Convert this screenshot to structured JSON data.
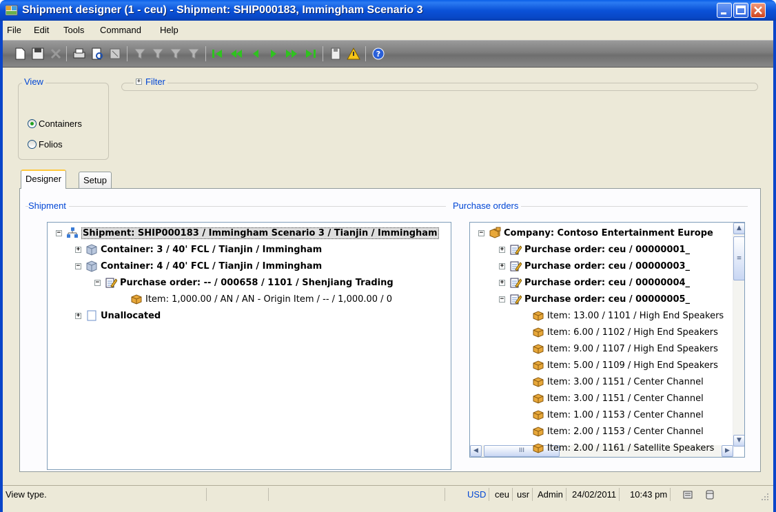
{
  "window": {
    "title": "Shipment designer (1 - ceu) - Shipment: SHIP000183, Immingham Scenario 3"
  },
  "menu": [
    "File",
    "Edit",
    "Tools",
    "Command",
    "Help"
  ],
  "view_group": {
    "legend": "View",
    "options": [
      {
        "label": "Containers",
        "selected": true
      },
      {
        "label": "Folios",
        "selected": false
      }
    ]
  },
  "filter_group": {
    "legend": "Filter",
    "expander": "+"
  },
  "tabs": [
    {
      "label": "Designer",
      "active": true
    },
    {
      "label": "Setup",
      "active": false
    }
  ],
  "shipment_panel": {
    "label": "Shipment",
    "nodes": [
      {
        "text": "Shipment: SHIP000183 / Immingham Scenario 3 / Tianjin / Immingham",
        "icon": "shipment-hierarchy-icon",
        "expander": "−",
        "bold": true,
        "selected": true
      },
      {
        "text": "Container: 3 / 40' FCL / Tianjin / Immingham",
        "icon": "container-icon",
        "expander": "+",
        "bold": true
      },
      {
        "text": "Container: 4 / 40' FCL / Tianjin / Immingham",
        "icon": "container-icon",
        "expander": "−",
        "bold": true
      },
      {
        "text": "Purchase order: -- / 000658 / 1101 / Shenjiang Trading",
        "icon": "purchase-order-icon",
        "expander": "−",
        "bold": true
      },
      {
        "text": "Item: 1,000.00 / AN / AN - Origin Item / -- / 1,000.00 / 0",
        "icon": "item-box-icon",
        "expander": "",
        "bold": false
      },
      {
        "text": "Unallocated",
        "icon": "unallocated-icon",
        "expander": "+",
        "bold": true
      }
    ]
  },
  "po_panel": {
    "label": "Purchase orders",
    "nodes": [
      {
        "text": "Company: Contoso Entertainment Europe",
        "icon": "company-icon",
        "expander": "−",
        "bold": true
      },
      {
        "text": "Purchase order: ceu / 00000001_",
        "icon": "purchase-order-icon",
        "expander": "+",
        "bold": true
      },
      {
        "text": "Purchase order: ceu / 00000003_",
        "icon": "purchase-order-icon",
        "expander": "+",
        "bold": true
      },
      {
        "text": "Purchase order: ceu / 00000004_",
        "icon": "purchase-order-icon",
        "expander": "+",
        "bold": true
      },
      {
        "text": "Purchase order: ceu / 00000005_",
        "icon": "purchase-order-icon",
        "expander": "−",
        "bold": true
      },
      {
        "text": "Item: 13.00 / 1101 / High End Speakers",
        "icon": "item-box-icon",
        "expander": "",
        "bold": false
      },
      {
        "text": "Item: 6.00 / 1102 / High End Speakers",
        "icon": "item-box-icon",
        "expander": "",
        "bold": false
      },
      {
        "text": "Item: 9.00 / 1107 / High End Speakers",
        "icon": "item-box-icon",
        "expander": "",
        "bold": false
      },
      {
        "text": "Item: 5.00 / 1109 / High End Speakers",
        "icon": "item-box-icon",
        "expander": "",
        "bold": false
      },
      {
        "text": "Item: 3.00 / 1151 / Center Channel",
        "icon": "item-box-icon",
        "expander": "",
        "bold": false
      },
      {
        "text": "Item: 3.00 / 1151 / Center Channel",
        "icon": "item-box-icon",
        "expander": "",
        "bold": false
      },
      {
        "text": "Item: 1.00 / 1153 / Center Channel",
        "icon": "item-box-icon",
        "expander": "",
        "bold": false
      },
      {
        "text": "Item: 2.00 / 1153 / Center Channel",
        "icon": "item-box-icon",
        "expander": "",
        "bold": false
      },
      {
        "text": "Item: 2.00 / 1161 / Satellite Speakers",
        "icon": "item-box-icon",
        "expander": "",
        "bold": false
      }
    ]
  },
  "statusbar": {
    "message": "View type.",
    "currency": "USD",
    "company": "ceu",
    "layer": "usr",
    "user": "Admin",
    "date": "24/02/2011",
    "time": "10:43 pm"
  },
  "colors": {
    "titlebar": "#0b52d8",
    "group_label": "#0046d5",
    "toolbar": "#7d7d7d",
    "nav_green": "#2fc21f",
    "item_box": "#e8a83a"
  }
}
